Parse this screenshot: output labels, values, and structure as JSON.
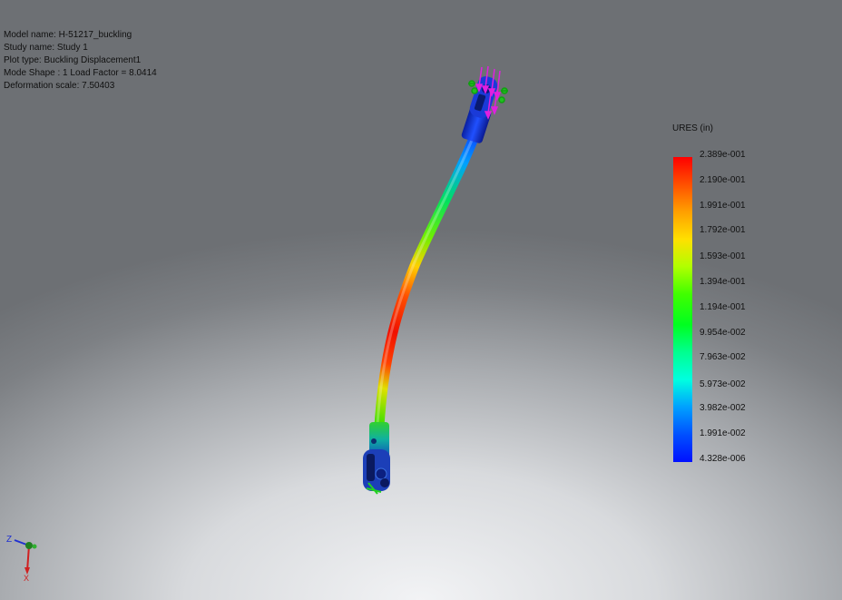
{
  "info": {
    "model_name": "Model name: H-51217_buckling",
    "study_name": "Study name: Study 1",
    "plot_type": "Plot type: Buckling Displacement1",
    "mode_shape": "Mode Shape : 1  Load Factor = 8.0414",
    "deformation_scale": "Deformation scale: 7.50403"
  },
  "legend": {
    "title": "URES (in)",
    "ticks": [
      "2.389e-001",
      "2.190e-001",
      "1.991e-001",
      "1.792e-001",
      "1.593e-001",
      "1.394e-001",
      "1.194e-001",
      "9.954e-002",
      "7.963e-002",
      "5.973e-002",
      "3.982e-002",
      "1.991e-002",
      "4.328e-006"
    ]
  },
  "triad": {
    "z_label": "Z",
    "x_label": "X"
  },
  "icons": [
    "load-arrow-icon",
    "fixture-icon",
    "triad-icon"
  ],
  "colors": {
    "max": "#ff0000",
    "mid": "#00ff00",
    "min": "#0010ff"
  }
}
